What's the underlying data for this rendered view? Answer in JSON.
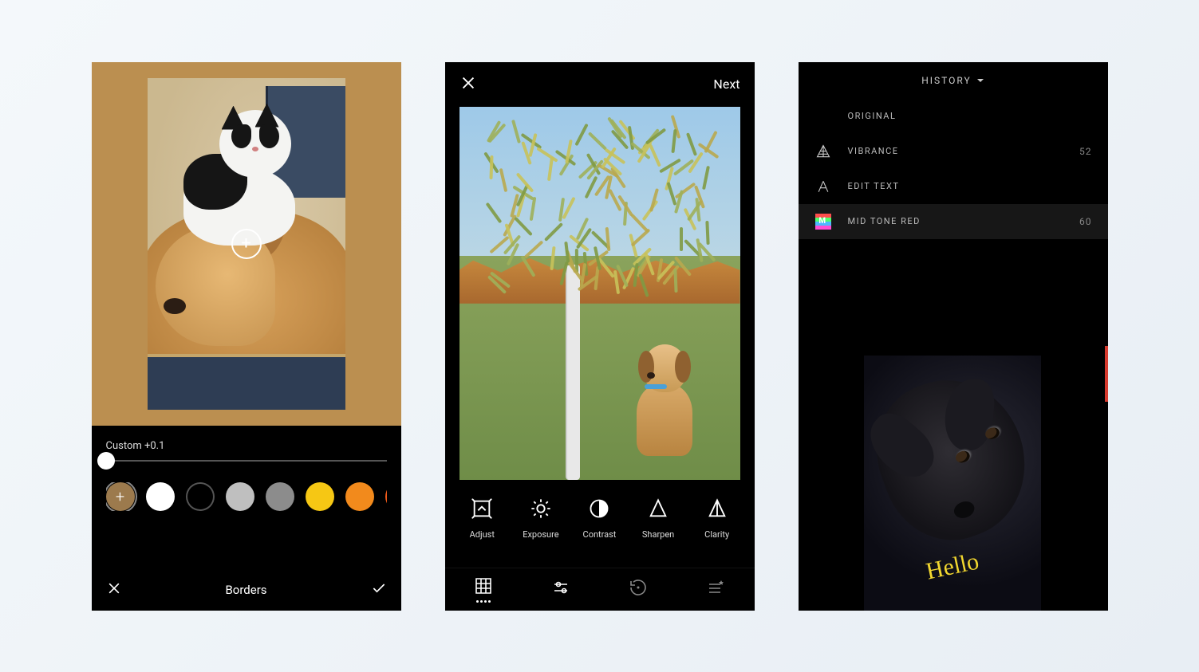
{
  "screen1": {
    "slider_label": "Custom  +0.1",
    "footer_title": "Borders",
    "swatches": [
      {
        "name": "custom",
        "color": "#9c7a4d",
        "selected": true
      },
      {
        "name": "white",
        "color": "#ffffff"
      },
      {
        "name": "black-outline",
        "color": "#000000",
        "outline": "#555"
      },
      {
        "name": "light-gray",
        "color": "#bfbfbf"
      },
      {
        "name": "gray",
        "color": "#8c8c8c"
      },
      {
        "name": "yellow",
        "color": "#f6c714"
      },
      {
        "name": "orange",
        "color": "#f28a1c"
      },
      {
        "name": "dark-orange",
        "color": "#ef5a1a"
      },
      {
        "name": "green",
        "color": "#6ac24a"
      }
    ]
  },
  "screen2": {
    "next": "Next",
    "tools": [
      {
        "key": "adjust",
        "label": "Adjust"
      },
      {
        "key": "exposure",
        "label": "Exposure"
      },
      {
        "key": "contrast",
        "label": "Contrast"
      },
      {
        "key": "sharpen",
        "label": "Sharpen"
      },
      {
        "key": "clarity",
        "label": "Clarity"
      }
    ]
  },
  "screen3": {
    "header": "HISTORY",
    "rows": [
      {
        "key": "original",
        "label": "ORIGINAL"
      },
      {
        "key": "vibrance",
        "label": "VIBRANCE",
        "value": "52"
      },
      {
        "key": "edit_text",
        "label": "EDIT TEXT"
      },
      {
        "key": "midtone",
        "label": "MID TONE RED",
        "value": "60",
        "highlight": true
      }
    ],
    "overlay_text": "Hello"
  }
}
